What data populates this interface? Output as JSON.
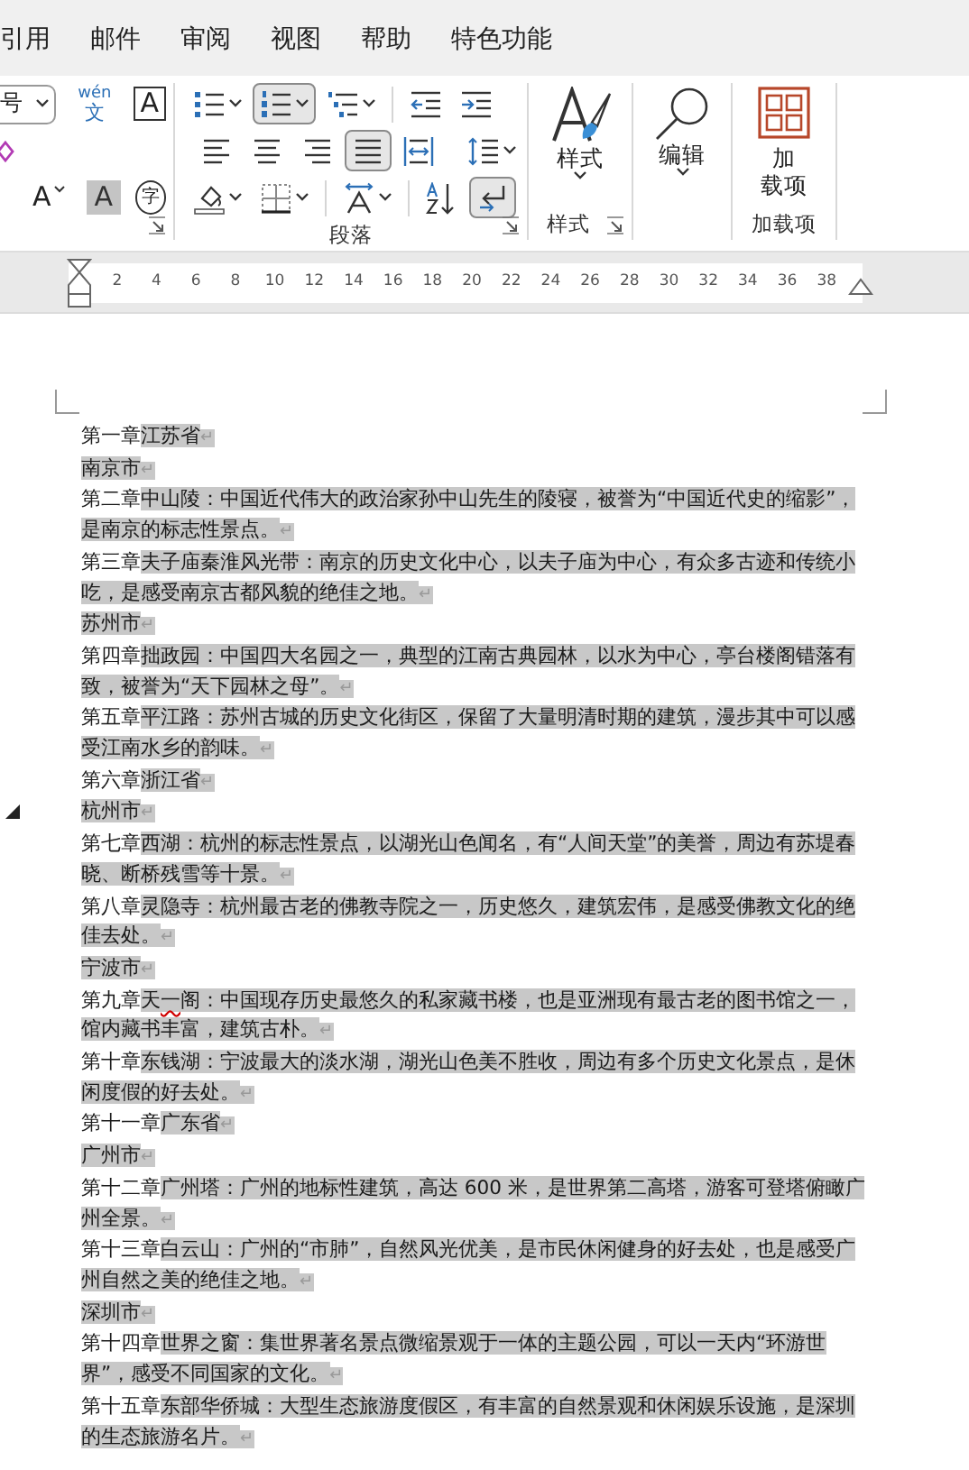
{
  "tabs": [
    {
      "label": "引用",
      "selected": false
    },
    {
      "label": "邮件",
      "selected": false
    },
    {
      "label": "审阅",
      "selected": false
    },
    {
      "label": "视图",
      "selected": false
    },
    {
      "label": "帮助",
      "selected": false
    },
    {
      "label": "特色功能",
      "selected": false
    }
  ],
  "font_group": {
    "size_value": "号",
    "tools": [
      {
        "kind": "phonetic",
        "glyph": "wén",
        "glyph2": "文"
      },
      {
        "kind": "char-border",
        "glyph": "A"
      },
      {
        "kind": "clear-format"
      },
      {
        "kind": "change-case",
        "glyph": "A"
      },
      {
        "kind": "char-shading",
        "glyph": "A"
      },
      {
        "kind": "enclose",
        "glyph": "字"
      }
    ]
  },
  "paragraph_group": {
    "label": "段落",
    "rows": [
      [
        {
          "kind": "bullets",
          "selected": false
        },
        {
          "kind": "numbering",
          "selected": true
        },
        {
          "kind": "multilevel",
          "selected": false
        },
        {
          "kind": "sep"
        },
        {
          "kind": "indent-decrease",
          "selected": false
        },
        {
          "kind": "indent-increase",
          "selected": false
        }
      ],
      [
        {
          "kind": "align-left",
          "selected": false
        },
        {
          "kind": "align-center",
          "selected": false
        },
        {
          "kind": "align-right",
          "selected": false
        },
        {
          "kind": "justify",
          "selected": true
        },
        {
          "kind": "distributed",
          "selected": false
        },
        {
          "kind": "sep"
        },
        {
          "kind": "line-spacing",
          "selected": false
        }
      ],
      [
        {
          "kind": "shading",
          "selected": false
        },
        {
          "kind": "borders",
          "selected": false
        },
        {
          "kind": "sep"
        },
        {
          "kind": "asian-layout",
          "selected": false
        },
        {
          "kind": "sep"
        },
        {
          "kind": "sort",
          "selected": false
        },
        {
          "kind": "show-marks",
          "selected": true
        }
      ]
    ]
  },
  "styles_group": {
    "button": "样式",
    "label": "样式"
  },
  "editing_group": {
    "button": "编辑"
  },
  "addins_group": {
    "button_lines": [
      "加",
      "载项"
    ],
    "label": "加载项"
  },
  "ruler": {
    "ticks": [
      "2",
      "4",
      "6",
      "8",
      "10",
      "12",
      "14",
      "16",
      "18",
      "20",
      "22",
      "24",
      "26",
      "28",
      "30",
      "32",
      "34",
      "36",
      "38"
    ]
  },
  "paragraphs": [
    {
      "collapsible": false,
      "runs": [
        {
          "text": "第一章",
          "highlighted": false,
          "flagged": false
        },
        {
          "text": "江苏省",
          "highlighted": true,
          "flagged": false
        }
      ],
      "mark": "↵"
    },
    {
      "collapsible": false,
      "runs": [
        {
          "text": "南京市",
          "highlighted": true,
          "flagged": false
        }
      ],
      "mark": "↵"
    },
    {
      "collapsible": false,
      "runs": [
        {
          "text": "第二章",
          "highlighted": false,
          "flagged": false
        },
        {
          "text": "中山陵：中国近代伟大的政治家孙中山先生的陵寝，被誉为“中国近代史的缩影”，是南京的标志性景点。",
          "highlighted": true,
          "flagged": false
        }
      ],
      "mark": "↵"
    },
    {
      "collapsible": false,
      "runs": [
        {
          "text": "第三章",
          "highlighted": false,
          "flagged": false
        },
        {
          "text": "夫子庙秦淮风光带：南京的历史文化中心，以夫子庙为中心，有众多古迹和传统小吃，是感受南京古都风貌的绝佳之地。",
          "highlighted": true,
          "flagged": false
        }
      ],
      "mark": "↵"
    },
    {
      "collapsible": false,
      "runs": [
        {
          "text": "苏州市",
          "highlighted": true,
          "flagged": false
        }
      ],
      "mark": "↵"
    },
    {
      "collapsible": false,
      "runs": [
        {
          "text": "第四章",
          "highlighted": false,
          "flagged": false
        },
        {
          "text": "拙政园：中国四大名园之一，典型的江南古典园林，以水为中心，亭台楼阁错落有致，被誉为“天下园林之母”。",
          "highlighted": true,
          "flagged": false
        }
      ],
      "mark": "↵"
    },
    {
      "collapsible": false,
      "runs": [
        {
          "text": "第五章",
          "highlighted": false,
          "flagged": false
        },
        {
          "text": "平江路：苏州古城的历史文化街区，保留了大量明清时期的建筑，漫步其中可以感受江南水乡的韵味。",
          "highlighted": true,
          "flagged": false
        }
      ],
      "mark": "↵"
    },
    {
      "collapsible": false,
      "runs": [
        {
          "text": "第六章",
          "highlighted": false,
          "flagged": false
        },
        {
          "text": "浙江省",
          "highlighted": true,
          "flagged": false
        }
      ],
      "mark": "↵"
    },
    {
      "collapsible": true,
      "runs": [
        {
          "text": "杭州市",
          "highlighted": true,
          "flagged": false
        }
      ],
      "mark": "↵"
    },
    {
      "collapsible": false,
      "runs": [
        {
          "text": "第七章",
          "highlighted": false,
          "flagged": false
        },
        {
          "text": "西湖：杭州的标志性景点，以湖光山色闻名，有“人间天堂”的美誉，周边有苏堤春晓、断桥残雪等十景。",
          "highlighted": true,
          "flagged": false
        }
      ],
      "mark": "↵"
    },
    {
      "collapsible": false,
      "runs": [
        {
          "text": "第八章",
          "highlighted": false,
          "flagged": false
        },
        {
          "text": "灵隐寺：杭州最古老的佛教寺院之一，历史悠久，建筑宏伟，是感受佛教文化的绝佳去处。",
          "highlighted": true,
          "flagged": false
        }
      ],
      "mark": "↵"
    },
    {
      "collapsible": false,
      "runs": [
        {
          "text": "宁波市",
          "highlighted": true,
          "flagged": false
        }
      ],
      "mark": "↵"
    },
    {
      "collapsible": false,
      "runs": [
        {
          "text": "第九章",
          "highlighted": false,
          "flagged": false
        },
        {
          "text": "天",
          "highlighted": true,
          "flagged": false
        },
        {
          "text": "一",
          "highlighted": true,
          "flagged": true
        },
        {
          "text": "阁：中国现存历史最悠久的私家藏书楼，也是亚洲现有最古老的图书馆之一，馆内藏书丰富，建筑古朴。",
          "highlighted": true,
          "flagged": false
        }
      ],
      "mark": "↵"
    },
    {
      "collapsible": false,
      "runs": [
        {
          "text": "第十章",
          "highlighted": false,
          "flagged": false
        },
        {
          "text": "东钱湖：宁波最大的淡水湖，湖光山色美不胜收，周边有多个历史文化景点，是休闲度假的好去处。",
          "highlighted": true,
          "flagged": false
        }
      ],
      "mark": "↵"
    },
    {
      "collapsible": false,
      "runs": [
        {
          "text": "第十一章",
          "highlighted": false,
          "flagged": false
        },
        {
          "text": "广东省",
          "highlighted": true,
          "flagged": false
        }
      ],
      "mark": "↵"
    },
    {
      "collapsible": false,
      "runs": [
        {
          "text": "广州市",
          "highlighted": true,
          "flagged": false
        }
      ],
      "mark": "↵"
    },
    {
      "collapsible": false,
      "runs": [
        {
          "text": "第十二章",
          "highlighted": false,
          "flagged": false
        },
        {
          "text": "广州塔：广州的地标性建筑，高达 600 米，是世界第二高塔，游客可登塔俯瞰广州全景。",
          "highlighted": true,
          "flagged": false
        }
      ],
      "mark": "↵"
    },
    {
      "collapsible": false,
      "runs": [
        {
          "text": "第十三章",
          "highlighted": false,
          "flagged": false
        },
        {
          "text": "白云山：广州的“市肺”，自然风光优美，是市民休闲健身的好去处，也是感受广州自然之美的绝佳之地。",
          "highlighted": true,
          "flagged": false
        }
      ],
      "mark": "↵"
    },
    {
      "collapsible": false,
      "runs": [
        {
          "text": "深圳市",
          "highlighted": true,
          "flagged": false
        }
      ],
      "mark": "↵"
    },
    {
      "collapsible": false,
      "runs": [
        {
          "text": "第十四章",
          "highlighted": false,
          "flagged": false
        },
        {
          "text": "世界之窗：集世界著名景点微缩景观于一体的主题公园，可以一天内“环游世界”，感受不同国家的文化。",
          "highlighted": true,
          "flagged": false
        }
      ],
      "mark": "↵"
    },
    {
      "collapsible": false,
      "runs": [
        {
          "text": "第十五章",
          "highlighted": false,
          "flagged": false
        },
        {
          "text": "东部华侨城：大型生态旅游度假区，有丰富的自然景观和休闲娱乐设施，是深圳的生态旅游名片。",
          "highlighted": true,
          "flagged": false
        }
      ],
      "mark": "↵"
    }
  ]
}
